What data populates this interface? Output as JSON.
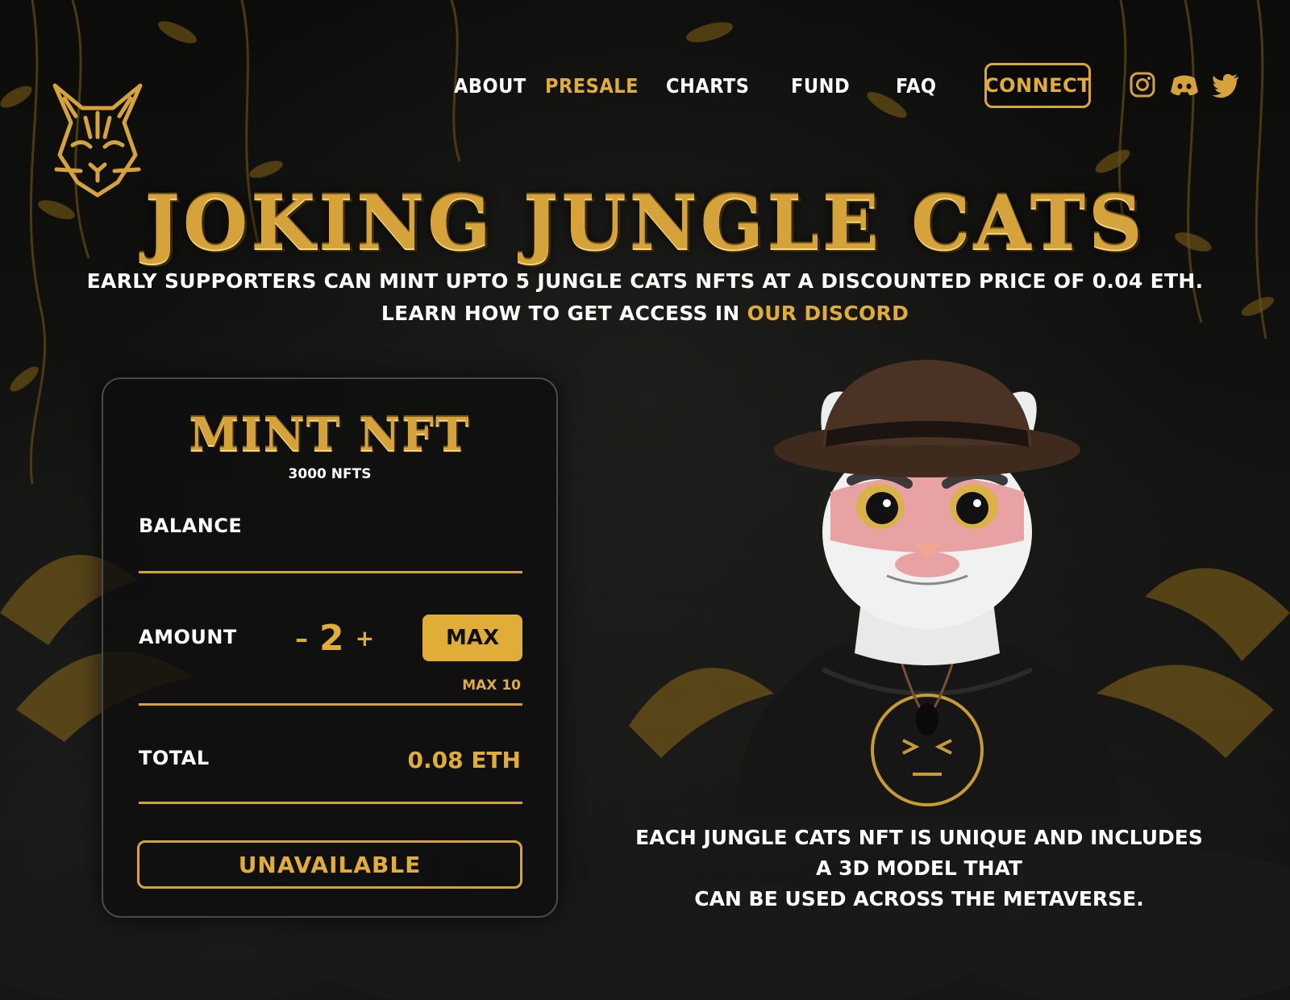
{
  "nav": {
    "items": [
      "ABOUT",
      "PRESALE",
      "CHARTS",
      "FUND",
      "FAQ"
    ],
    "active": "PRESALE",
    "connect_label": "CONNECT",
    "social_icons": [
      "instagram-icon",
      "discord-icon",
      "twitter-icon"
    ]
  },
  "hero": {
    "title": "JOKING JUNGLE CATS",
    "line1": "EARLY SUPPORTERS CAN MINT UPTO 5 JUNGLE CATS NFTS AT A DISCOUNTED PRICE OF 0.04 ETH.",
    "line2_prefix": "LEARN HOW TO GET ACCESS IN ",
    "line2_link": "OUR DISCORD"
  },
  "mint": {
    "title": "MINT NFT",
    "subtitle": "3000 NFTS",
    "balance_label": "BALANCE",
    "amount_label": "AMOUNT",
    "minus": "–",
    "amount_value": "2",
    "plus": "+",
    "max_label": "MAX",
    "max_note": "MAX 10",
    "total_label": "TOTAL",
    "total_value": "0.08 ETH",
    "action_label": "UNAVAILABLE"
  },
  "description": {
    "line1": "EACH JUNGLE CATS NFT IS UNIQUE AND INCLUDES A 3D MODEL THAT",
    "line2": "CAN BE USED ACROSS THE METAVERSE."
  },
  "colors": {
    "accent": "#e0ad37",
    "background": "#090909",
    "card": "#0e0e0e"
  }
}
